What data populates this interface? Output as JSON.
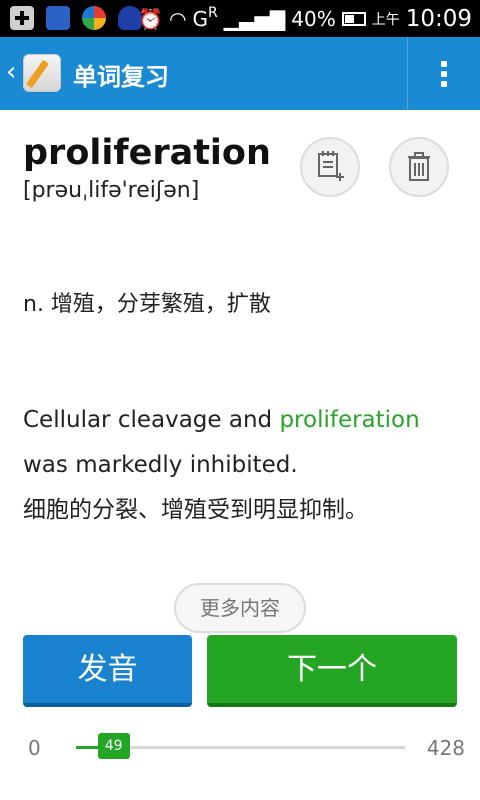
{
  "status_bar": {
    "network_label": "G",
    "network_sub": "R",
    "battery": "40%",
    "ampm": "上午",
    "time": "10:09"
  },
  "app_bar": {
    "title": "单词复习"
  },
  "word": {
    "text": "proliferation",
    "phonetic": "[prəuˌlifə'reiʃən]",
    "meaning": "n. 增殖，分芽繁殖，扩散"
  },
  "example": {
    "before": "Cellular cleavage and ",
    "highlight": "proliferation",
    "after": " was markedly inhibited.",
    "translation": "细胞的分裂、增殖受到明显抑制。"
  },
  "more_label": "更多内容",
  "buttons": {
    "speak": "发音",
    "next": "下一个"
  },
  "progress": {
    "min": "0",
    "max": "428",
    "current": "49",
    "fraction": 0.1145
  },
  "colors": {
    "app_bar": "#1a8bd2",
    "speak_button": "#1a83cf",
    "next_button": "#24a524",
    "highlight": "#2aa32a"
  }
}
